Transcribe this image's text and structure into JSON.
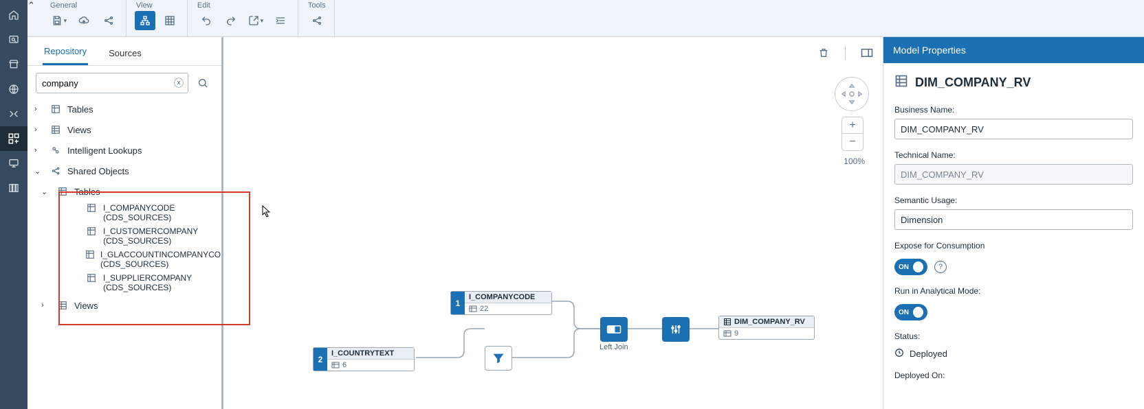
{
  "ribbon": {
    "groups": {
      "general": "General",
      "view": "View",
      "edit": "Edit",
      "tools": "Tools"
    }
  },
  "side_tabs": {
    "repository": "Repository",
    "sources": "Sources"
  },
  "search": {
    "value": "company"
  },
  "tree": {
    "tables": "Tables",
    "views": "Views",
    "intelligent_lookups": "Intelligent Lookups",
    "shared_objects": "Shared Objects",
    "shared_tables": "Tables",
    "shared_views": "Views",
    "items": [
      {
        "name": "I_COMPANYCODE",
        "src": "(CDS_SOURCES)"
      },
      {
        "name": "I_CUSTOMERCOMPANY",
        "src": "(CDS_SOURCES)"
      },
      {
        "name": "I_GLACCOUNTINCOMPANYCO",
        "src": "(CDS_SOURCES)"
      },
      {
        "name": "I_SUPPLIERCOMPANY",
        "src": "(CDS_SOURCES)"
      }
    ]
  },
  "canvas": {
    "zoom": "100%",
    "join_label": "Left Join",
    "nodes": {
      "n1": {
        "seq": "1",
        "title": "I_COMPANYCODE",
        "count": "22"
      },
      "n2": {
        "seq": "2",
        "title": "I_COUNTRYTEXT",
        "count": "6"
      },
      "out": {
        "title": "DIM_COMPANY_RV",
        "count": "9"
      }
    }
  },
  "props": {
    "panel_title": "Model Properties",
    "object_name": "DIM_COMPANY_RV",
    "business_name_label": "Business Name:",
    "business_name": "DIM_COMPANY_RV",
    "technical_name_label": "Technical Name:",
    "technical_name": "DIM_COMPANY_RV",
    "semantic_usage_label": "Semantic Usage:",
    "semantic_usage": "Dimension",
    "expose_label": "Expose for Consumption",
    "run_label": "Run in Analytical Mode:",
    "toggle_on": "ON",
    "status_label": "Status:",
    "status_value": "Deployed",
    "deployed_on_label": "Deployed On:"
  }
}
